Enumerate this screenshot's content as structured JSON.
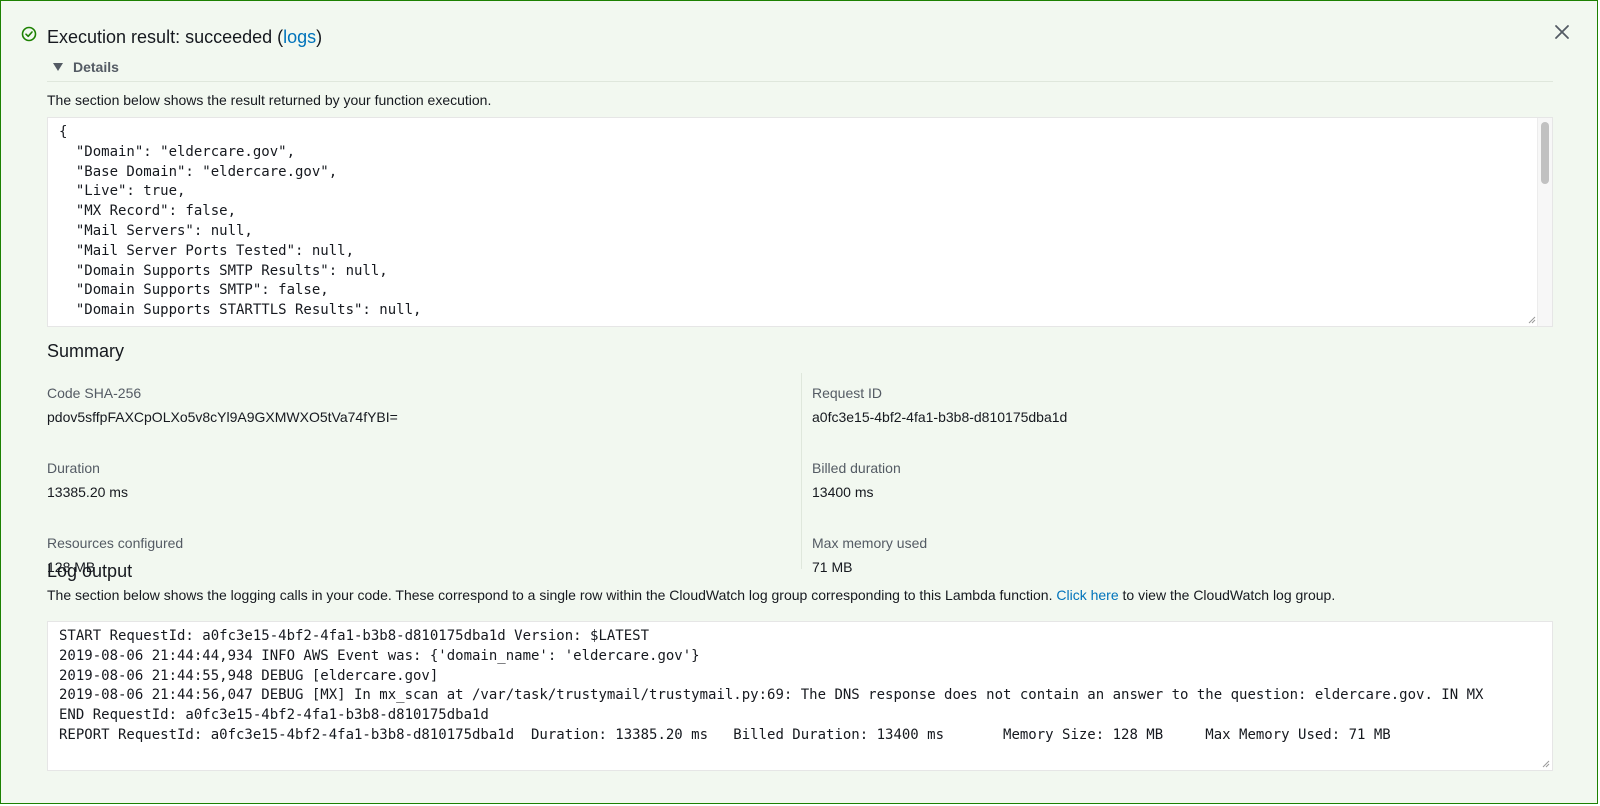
{
  "header": {
    "title_prefix": "Execution result: succeeded (",
    "logs_link": "logs",
    "title_suffix": ")"
  },
  "details": {
    "toggle_label": "Details",
    "description": "The section below shows the result returned by your function execution.",
    "result_lines": [
      "{",
      "  \"Domain\": \"eldercare.gov\",",
      "  \"Base Domain\": \"eldercare.gov\",",
      "  \"Live\": true,",
      "  \"MX Record\": false,",
      "  \"Mail Servers\": null,",
      "  \"Mail Server Ports Tested\": null,",
      "  \"Domain Supports SMTP Results\": null,",
      "  \"Domain Supports SMTP\": false,",
      "  \"Domain Supports STARTTLS Results\": null,"
    ]
  },
  "summary": {
    "title": "Summary",
    "left": [
      {
        "label": "Code SHA-256",
        "value": "pdov5sffpFAXCpOLXo5v8cYl9A9GXMWXO5tVa74fYBI="
      },
      {
        "label": "Duration",
        "value": "13385.20 ms"
      },
      {
        "label": "Resources configured",
        "value": "128 MB"
      }
    ],
    "right": [
      {
        "label": "Request ID",
        "value": "a0fc3e15-4bf2-4fa1-b3b8-d810175dba1d"
      },
      {
        "label": "Billed duration",
        "value": "13400 ms"
      },
      {
        "label": "Max memory used",
        "value": "71 MB"
      }
    ]
  },
  "log_output": {
    "title": "Log output",
    "description_prefix": "The section below shows the logging calls in your code. These correspond to a single row within the CloudWatch log group corresponding to this Lambda function. ",
    "click_here_link": "Click here",
    "description_suffix": " to view the CloudWatch log group.",
    "lines": [
      "START RequestId: a0fc3e15-4bf2-4fa1-b3b8-d810175dba1d Version: $LATEST",
      "2019-08-06 21:44:44,934 INFO AWS Event was: {'domain_name': 'eldercare.gov'}",
      "2019-08-06 21:44:55,948 DEBUG [eldercare.gov]",
      "2019-08-06 21:44:56,047 DEBUG [MX] In mx_scan at /var/task/trustymail/trustymail.py:69: The DNS response does not contain an answer to the question: eldercare.gov. IN MX",
      "END RequestId: a0fc3e15-4bf2-4fa1-b3b8-d810175dba1d",
      "REPORT RequestId: a0fc3e15-4bf2-4fa1-b3b8-d810175dba1d  Duration: 13385.20 ms   Billed Duration: 13400 ms       Memory Size: 128 MB     Max Memory Used: 71 MB"
    ]
  },
  "icons": {
    "success": "check-circle-icon",
    "close": "close-icon",
    "caret": "caret-down-icon"
  },
  "colors": {
    "success_green": "#1d8102",
    "panel_bg": "#f2f8f0",
    "link_blue": "#0073bb"
  }
}
